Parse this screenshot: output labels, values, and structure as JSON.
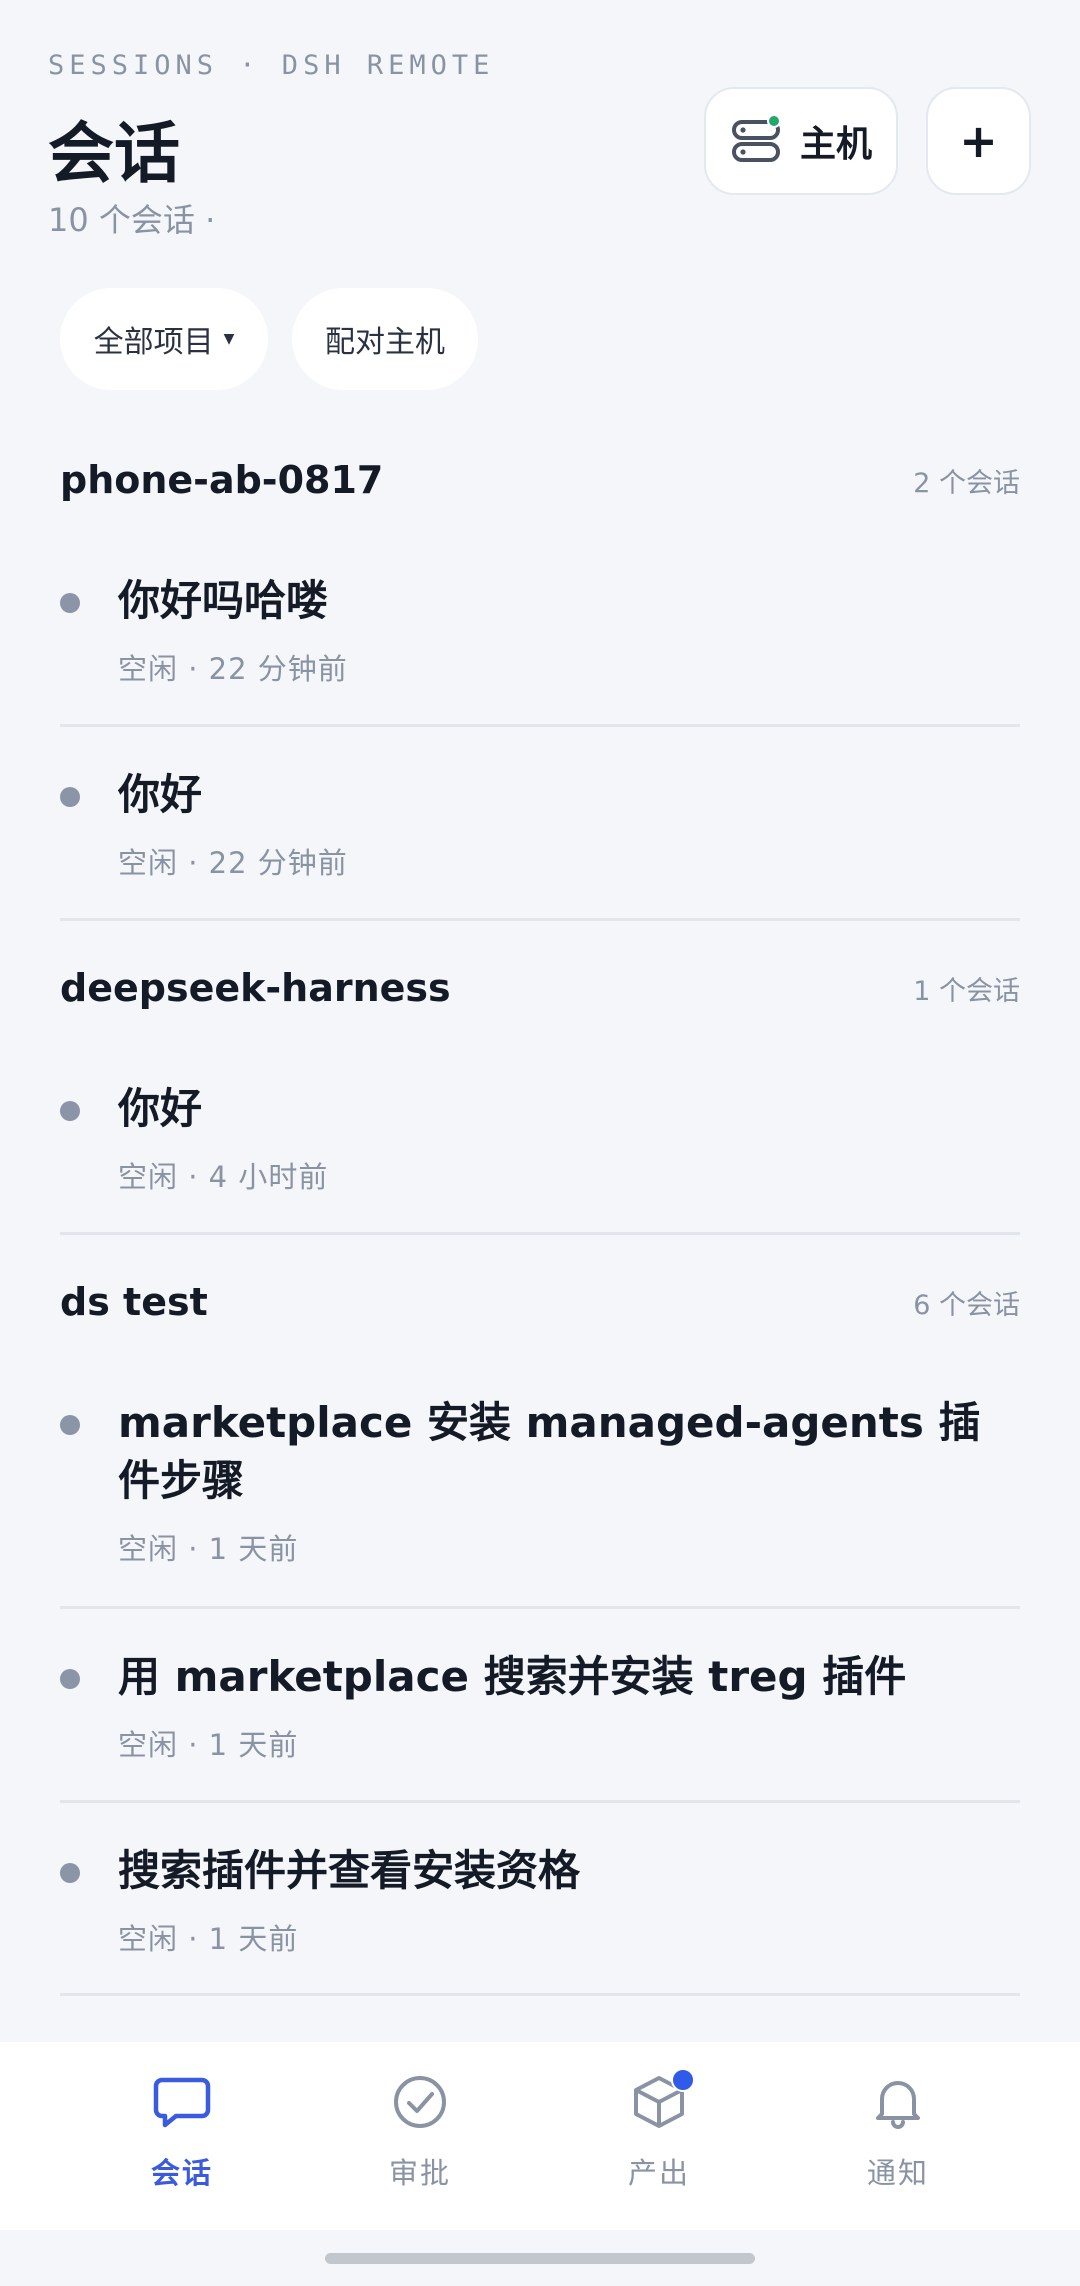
{
  "header": {
    "eyebrow": "SESSIONS · DSH REMOTE",
    "title": "会话",
    "subtitle": "10 个会话 ·",
    "host_button_label": "主机",
    "add_button_label": "+"
  },
  "filters": {
    "all_projects": "全部项目",
    "pair_host": "配对主机"
  },
  "groups": [
    {
      "name": "phone-ab-0817",
      "count": "2 个会话",
      "sessions": [
        {
          "title": "你好吗哈喽",
          "meta": "空闲 · 22 分钟前"
        },
        {
          "title": "你好",
          "meta": "空闲 · 22 分钟前"
        }
      ]
    },
    {
      "name": "deepseek-harness",
      "count": "1 个会话",
      "sessions": [
        {
          "title": "你好",
          "meta": "空闲 · 4 小时前"
        }
      ]
    },
    {
      "name": "ds test",
      "count": "6 个会话",
      "sessions": [
        {
          "title": "marketplace 安装 managed-agents 插件步骤",
          "meta": "空闲 · 1 天前"
        },
        {
          "title": "用 marketplace 搜索并安装 treg 插件",
          "meta": "空闲 · 1 天前"
        },
        {
          "title": "搜索插件并查看安装资格",
          "meta": "空闲 · 1 天前"
        }
      ]
    }
  ],
  "tabbar": {
    "tabs": [
      {
        "label": "会话",
        "icon": "chat-icon",
        "active": true
      },
      {
        "label": "审批",
        "icon": "check-circle-icon",
        "active": false
      },
      {
        "label": "产出",
        "icon": "box-icon",
        "active": false,
        "badge": true
      },
      {
        "label": "通知",
        "icon": "bell-icon",
        "active": false
      }
    ]
  },
  "colors": {
    "accent": "#3a5be0",
    "status_online": "#22a86b",
    "background": "#f4f6fa"
  }
}
